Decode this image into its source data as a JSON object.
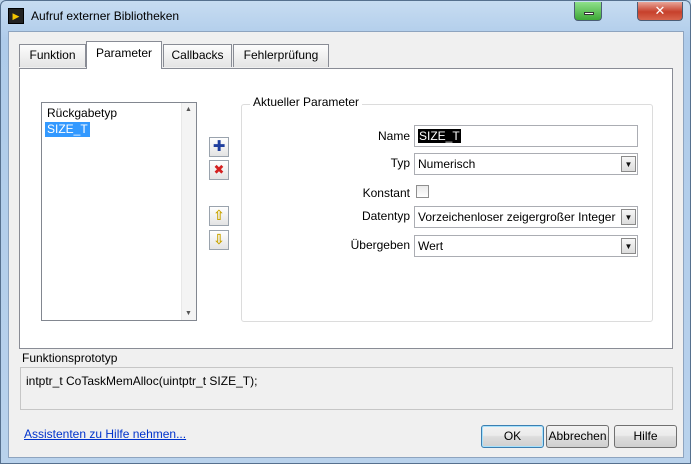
{
  "window": {
    "title": "Aufruf externer Bibliotheken",
    "close_glyph": "✕"
  },
  "tabs": [
    {
      "label": "Funktion"
    },
    {
      "label": "Parameter"
    },
    {
      "label": "Callbacks"
    },
    {
      "label": "Fehlerprüfung"
    }
  ],
  "active_tab": "Parameter",
  "param_list": {
    "items": [
      "Rückgabetyp",
      "SIZE_T"
    ],
    "selected": "SIZE_T"
  },
  "param_buttons": {
    "add_glyph": "✚",
    "remove_glyph": "✖",
    "up_glyph": "⇧",
    "down_glyph": "⇩"
  },
  "current_param": {
    "group_title": "Aktueller Parameter",
    "name_label": "Name",
    "name_value": "SIZE_T",
    "type_label": "Typ",
    "type_value": "Numerisch",
    "const_label": "Konstant",
    "const_checked": false,
    "datatype_label": "Datentyp",
    "datatype_value": "Vorzeichenloser zeigergroßer Integer",
    "pass_label": "Übergeben",
    "pass_value": "Wert"
  },
  "prototype": {
    "label": "Funktionsprototyp",
    "text": "intptr_t CoTaskMemAlloc(uintptr_t SIZE_T);"
  },
  "footer": {
    "help_link": "Assistenten zu Hilfe nehmen...",
    "ok_label": "OK",
    "cancel_label": "Abbrechen",
    "help_label": "Hilfe"
  },
  "colors": {
    "selection": "#3399ff",
    "add_icon": "#1f3f9e",
    "remove_icon": "#d42020",
    "arrow_icon": "#c9a400",
    "link": "#0033cc"
  }
}
